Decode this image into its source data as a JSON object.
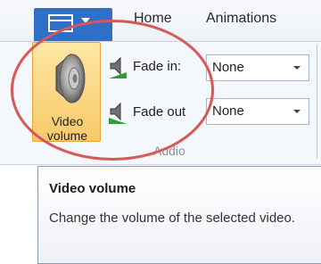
{
  "tabs": {
    "home": "Home",
    "animations": "Animations"
  },
  "video_volume": {
    "line1": "Video",
    "line2": "volume"
  },
  "fade_in": {
    "label": "Fade in:",
    "value": "None"
  },
  "fade_out": {
    "label": "Fade out",
    "value": "None"
  },
  "group": {
    "label": "Audio"
  },
  "tooltip": {
    "title": "Video volume",
    "body": "Change the volume of the selected video."
  },
  "icons": {
    "app_menu": "document-icon",
    "app_menu_caret": "chevron-down-icon",
    "video_volume": "speaker-icon",
    "fade_in": "fade-in-speaker-icon",
    "fade_out": "fade-out-speaker-icon"
  },
  "colors": {
    "app_menu": "#2f6fc5",
    "button_active": "#f8c96a",
    "highlight": "#d45a5a",
    "fade_indicator": "#2e9e3a"
  }
}
